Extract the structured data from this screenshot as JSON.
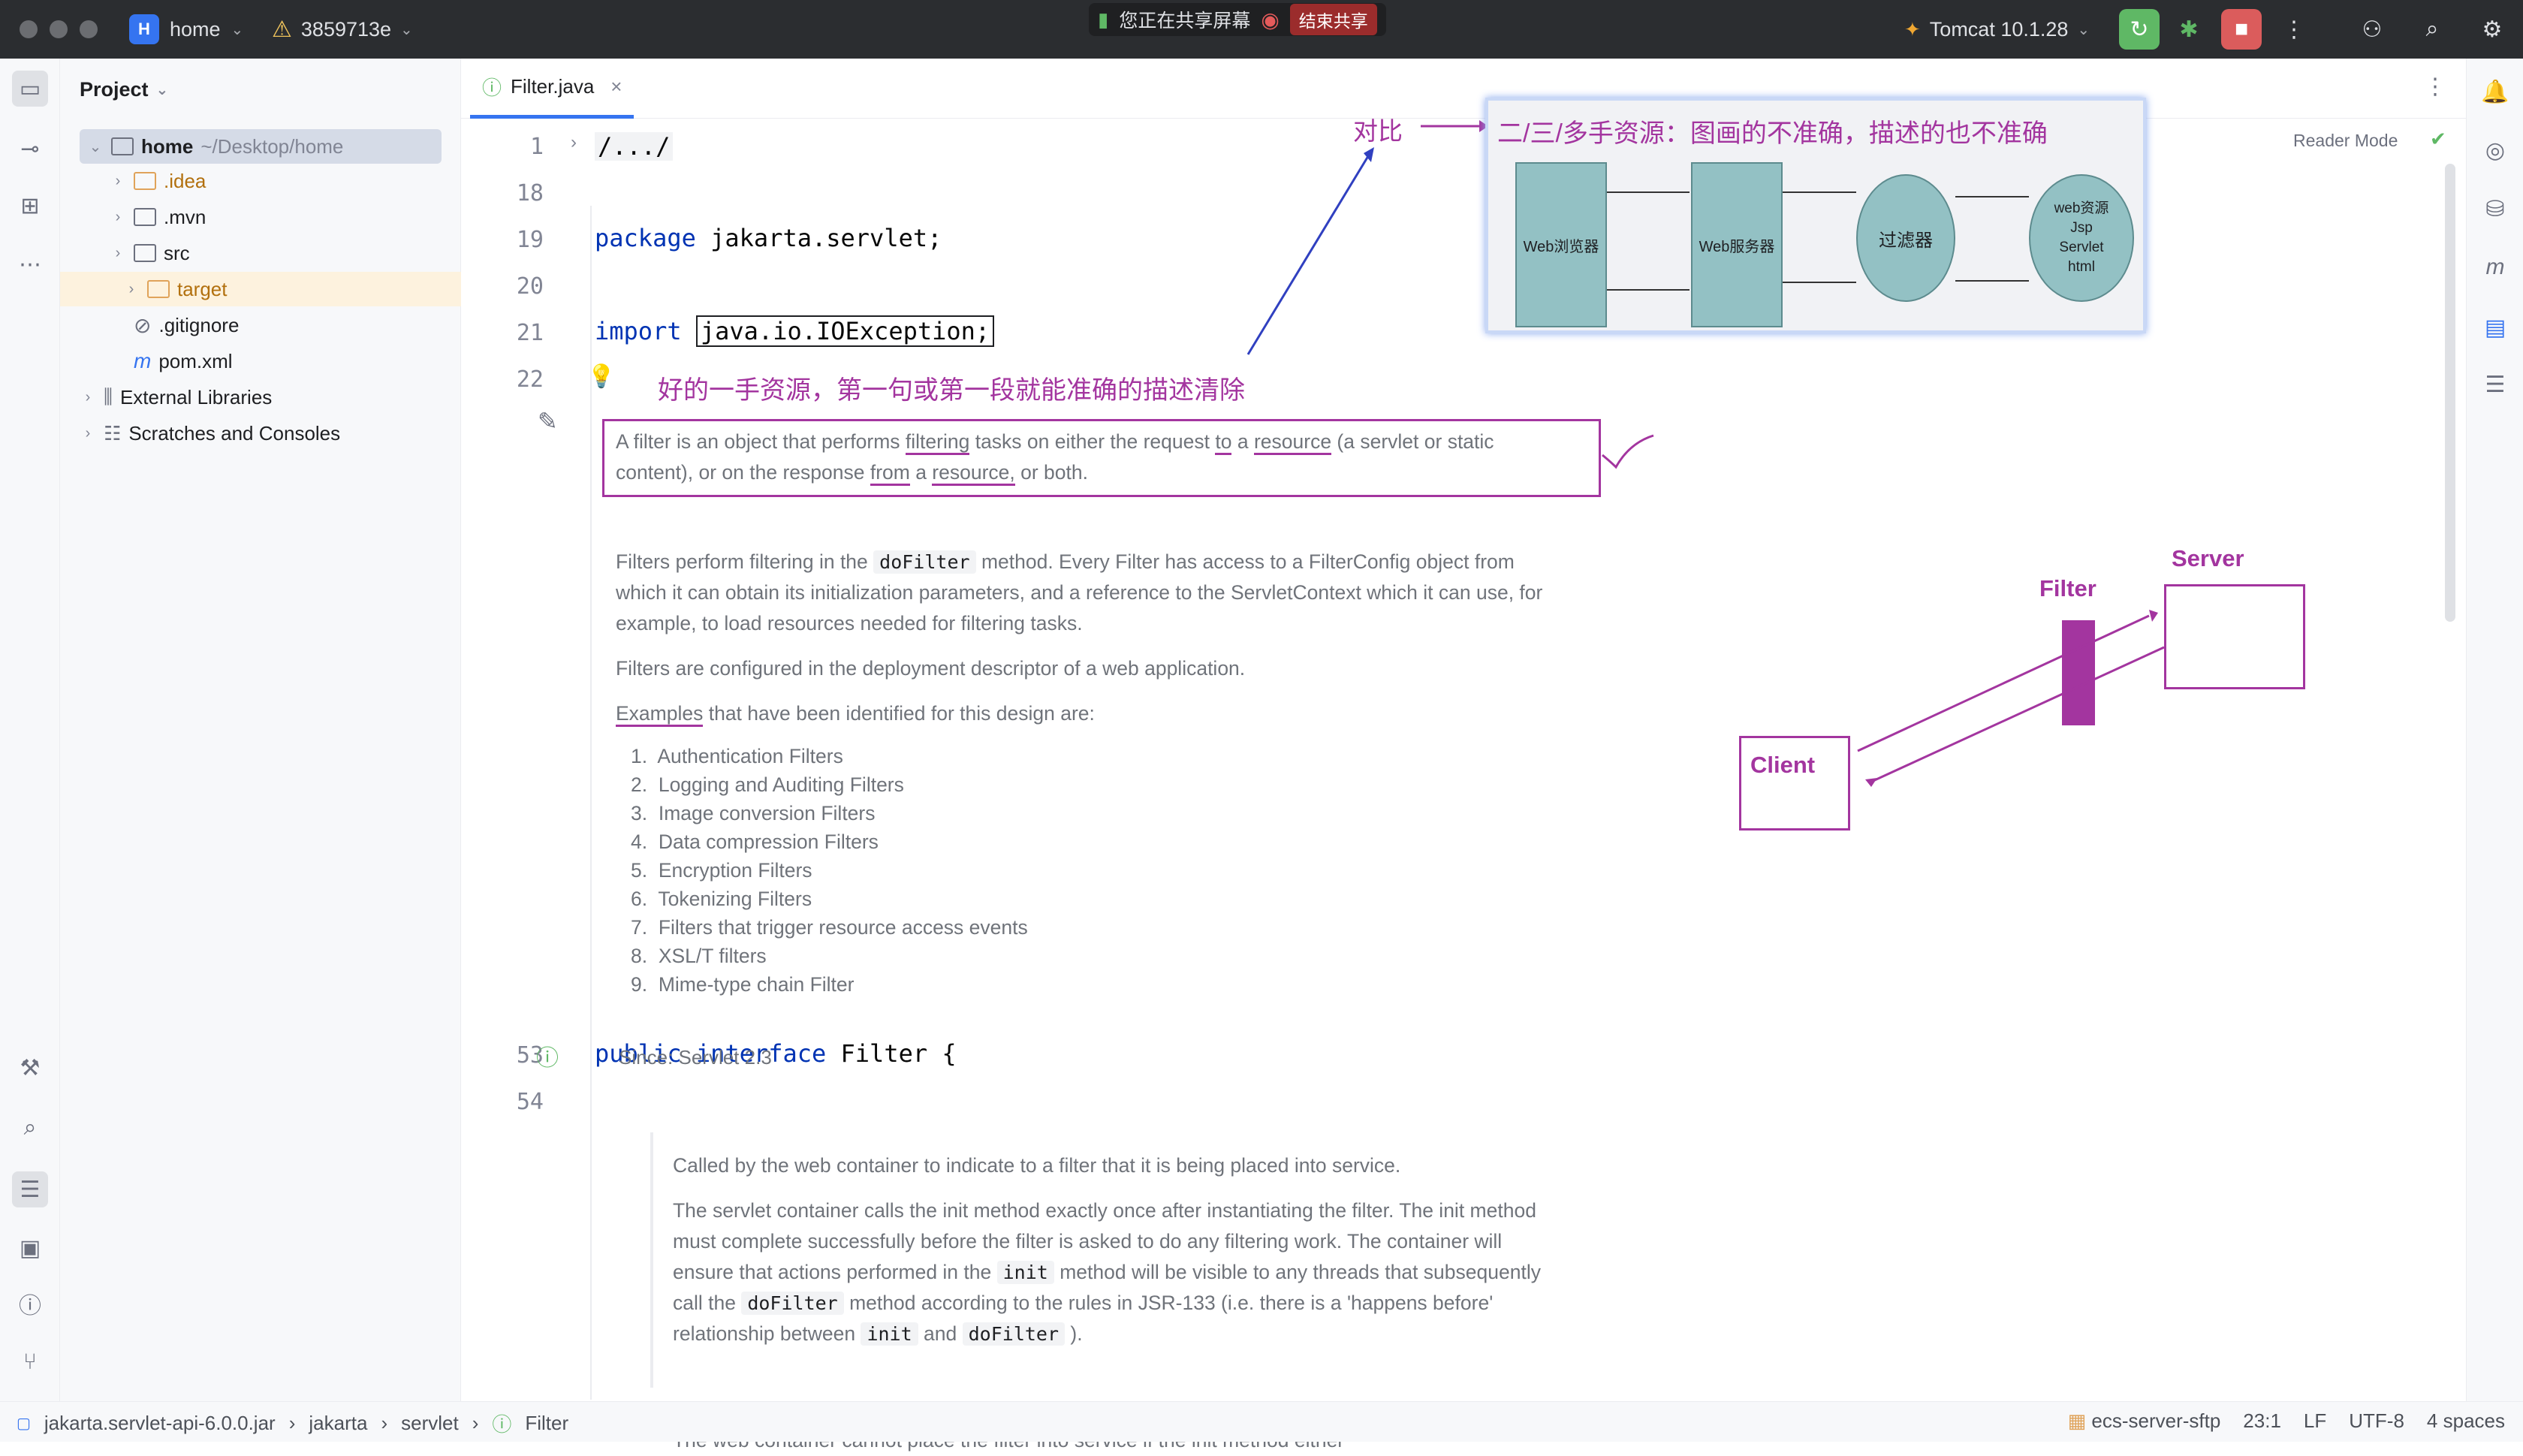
{
  "titlebar": {
    "project_initial": "H",
    "project_name": "home",
    "vcs_label": "3859713e",
    "share_text": "您正在共享屏幕",
    "share_end": "结束共享",
    "run_config": "Tomcat 10.1.28"
  },
  "project_panel": {
    "title": "Project",
    "tree": [
      {
        "label": "home",
        "hint": "~/Desktop/home",
        "type": "folder"
      },
      {
        "label": ".idea",
        "type": "folder"
      },
      {
        "label": ".mvn",
        "type": "folder"
      },
      {
        "label": "src",
        "type": "folder"
      },
      {
        "label": "target",
        "type": "folder"
      },
      {
        "label": ".gitignore",
        "type": "file"
      },
      {
        "label": "pom.xml",
        "type": "file"
      },
      {
        "label": "External Libraries",
        "type": "library"
      },
      {
        "label": "Scratches and Consoles",
        "type": "scratch"
      }
    ]
  },
  "editor": {
    "tab_label": "Filter.java",
    "reader_mode": "Reader Mode",
    "line_numbers": [
      "1",
      "18",
      "19",
      "20",
      "21",
      "22",
      "53",
      "54"
    ],
    "code": {
      "line1": "/.../",
      "pkg_kw": "package",
      "pkg_name": " jakarta.servlet;",
      "import_kw": "import",
      "import_name": "java.io.IOException;",
      "class_kw1": "public",
      "class_kw2": "interface",
      "class_name": " Filter {"
    },
    "doc1": {
      "p1_a": "A filter is an object that performs ",
      "p1_b": "filtering",
      "p1_c": " tasks on either the request ",
      "p1_d": "to",
      "p1_e": " a ",
      "p1_f": "resource",
      "p1_g": " (a servlet or static",
      "p1_h": "content), or on the response ",
      "p1_i": "from",
      "p1_j": " a ",
      "p1_k": "resource,",
      "p1_l": " or both.",
      "p2_a": "Filters perform filtering in the ",
      "p2_code": "doFilter",
      "p2_b": " method. Every Filter has access to a FilterConfig object from",
      "p2_c": "which it can obtain its initialization parameters, and a reference to the ServletContext which it can use, for",
      "p2_d": "example, to load resources needed for filtering tasks.",
      "p3": "Filters are configured in the deployment descriptor of a web application.",
      "p4_a": "Examples",
      "p4_b": " that have been identified for this design are:",
      "list": [
        "Authentication Filters",
        "Logging and Auditing Filters",
        "Image conversion Filters",
        "Data compression Filters",
        "Encryption Filters",
        "Tokenizing Filters",
        "Filters that trigger resource access events",
        "XSL/T filters",
        "Mime-type chain Filter"
      ],
      "since": "Since: Servlet 2.3"
    },
    "doc2": {
      "p1": "Called by the web container to indicate to a filter that it is being placed into service.",
      "p2_a": "The servlet container calls the init method exactly once after instantiating the filter. The init method",
      "p2_b": "must complete successfully before the filter is asked to do any filtering work. The container will",
      "p2_c1": "ensure that actions performed in the ",
      "p2_code1": "init",
      "p2_c2": " method will be visible to any threads that subsequently",
      "p2_d1": "call the ",
      "p2_code2": "doFilter",
      "p2_d2": " method according to the rules in JSR-133 (i.e. there is a 'happens before'",
      "p2_e1": "relationship between ",
      "p2_code3": "init",
      "p2_e2": " and ",
      "p2_code4": "doFilter",
      "p2_e3": " ).",
      "p3": "The web container cannot place the filter into service if the init method either"
    }
  },
  "annotations": {
    "first_hand_note": "好的一手资源，第一句或第一段就能准确的描述清除",
    "compare_label": "对比",
    "diagram_caption": "二/三/多手资源：图画的不准确，描述的也不准确",
    "diagram_browser": "Web浏览器",
    "diagram_server": "Web服务器",
    "diagram_filter": "过滤器",
    "diagram_resources": [
      "web资源",
      "Jsp",
      "Servlet",
      "html"
    ],
    "sketch_filter": "Filter",
    "sketch_server": "Server",
    "sketch_client": "Client",
    "color": "#a3359f"
  },
  "statusbar": {
    "crumbs": [
      "jakarta.servlet-api-6.0.0.jar",
      "jakarta",
      "servlet",
      "Filter"
    ],
    "vcs": "ecs-server-sftp",
    "position": "23:1",
    "line_sep": "LF",
    "encoding": "UTF-8",
    "indent": "4 spaces"
  }
}
